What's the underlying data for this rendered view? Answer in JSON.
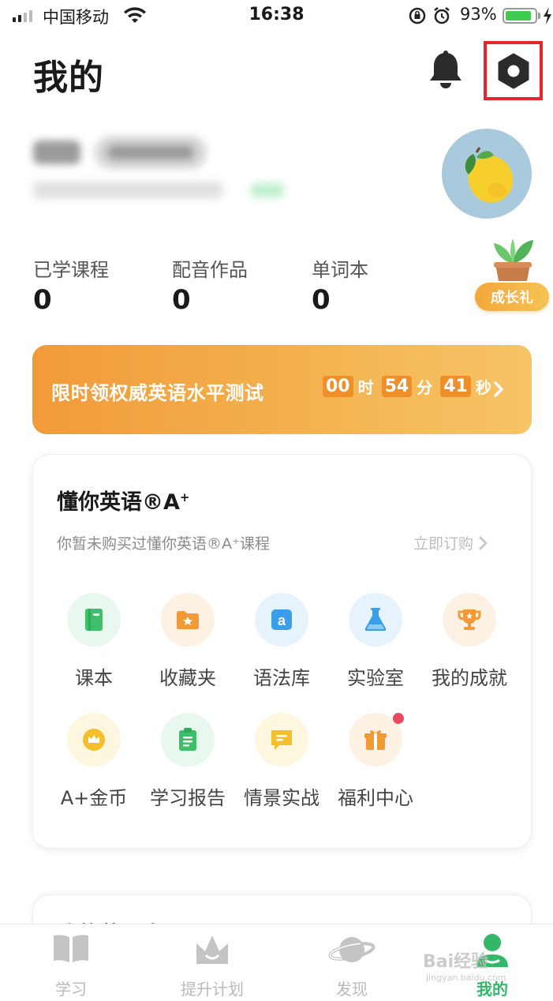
{
  "status_bar": {
    "carrier": "中国移动",
    "time": "16:38",
    "battery": "93%",
    "battery_level": 0.93
  },
  "header": {
    "title": "我的",
    "icons": [
      "bell-icon",
      "settings-hexagon-icon"
    ],
    "highlight_color": "#e8262a"
  },
  "profile": {
    "avatar": "lemon-avatar"
  },
  "stats": [
    {
      "label": "已学课程",
      "value": "0"
    },
    {
      "label": "配音作品",
      "value": "0"
    },
    {
      "label": "单词本",
      "value": "0"
    }
  ],
  "growth": {
    "label": "成长礼",
    "icon": "potted-plant-icon"
  },
  "promo": {
    "text": "限时领权威英语水平测试",
    "hours": "00",
    "hours_unit": "时",
    "minutes": "54",
    "minutes_unit": "分",
    "seconds": "41",
    "seconds_unit": "秒"
  },
  "course_card": {
    "title": "懂你英语",
    "title_suffix": "®A",
    "title_sup": "+",
    "subtitle": "你暂未购买过懂你英语®A⁺课程",
    "subscribe": "立即订购",
    "items": [
      {
        "label": "课本",
        "icon": "book-icon",
        "color": "#3fbf6a",
        "bg": "#e9f8ee"
      },
      {
        "label": "收藏夹",
        "icon": "star-folder-icon",
        "color": "#f29a38",
        "bg": "#fdf1e4"
      },
      {
        "label": "语法库",
        "icon": "letter-a-icon",
        "color": "#3a9ee8",
        "bg": "#e6f3fd"
      },
      {
        "label": "实验室",
        "icon": "flask-icon",
        "color": "#3a9ee8",
        "bg": "#e6f3fd"
      },
      {
        "label": "我的成就",
        "icon": "trophy-icon",
        "color": "#f29a38",
        "bg": "#fdf1e4"
      },
      {
        "label": "A+金币",
        "icon": "crown-coin-icon",
        "color": "#f4bf2a",
        "bg": "#fef7e0"
      },
      {
        "label": "学习报告",
        "icon": "clipboard-icon",
        "color": "#3fbf6a",
        "bg": "#e9f8ee"
      },
      {
        "label": "情景实战",
        "icon": "chat-icon",
        "color": "#f4bf2a",
        "bg": "#fef7e0"
      },
      {
        "label": "福利中心",
        "icon": "gift-icon",
        "color": "#f29a38",
        "bg": "#fdf1e4"
      }
    ]
  },
  "second_card": {
    "title": "我的英语水平"
  },
  "tabs": [
    {
      "label": "学习",
      "icon": "open-book-icon"
    },
    {
      "label": "提升计划",
      "icon": "crown-icon"
    },
    {
      "label": "发现",
      "icon": "planet-icon"
    },
    {
      "label": "我的",
      "icon": "user-icon",
      "active": true
    }
  ],
  "watermark": {
    "text": "Bai经验",
    "sub": "jingyan.baidu.com"
  }
}
